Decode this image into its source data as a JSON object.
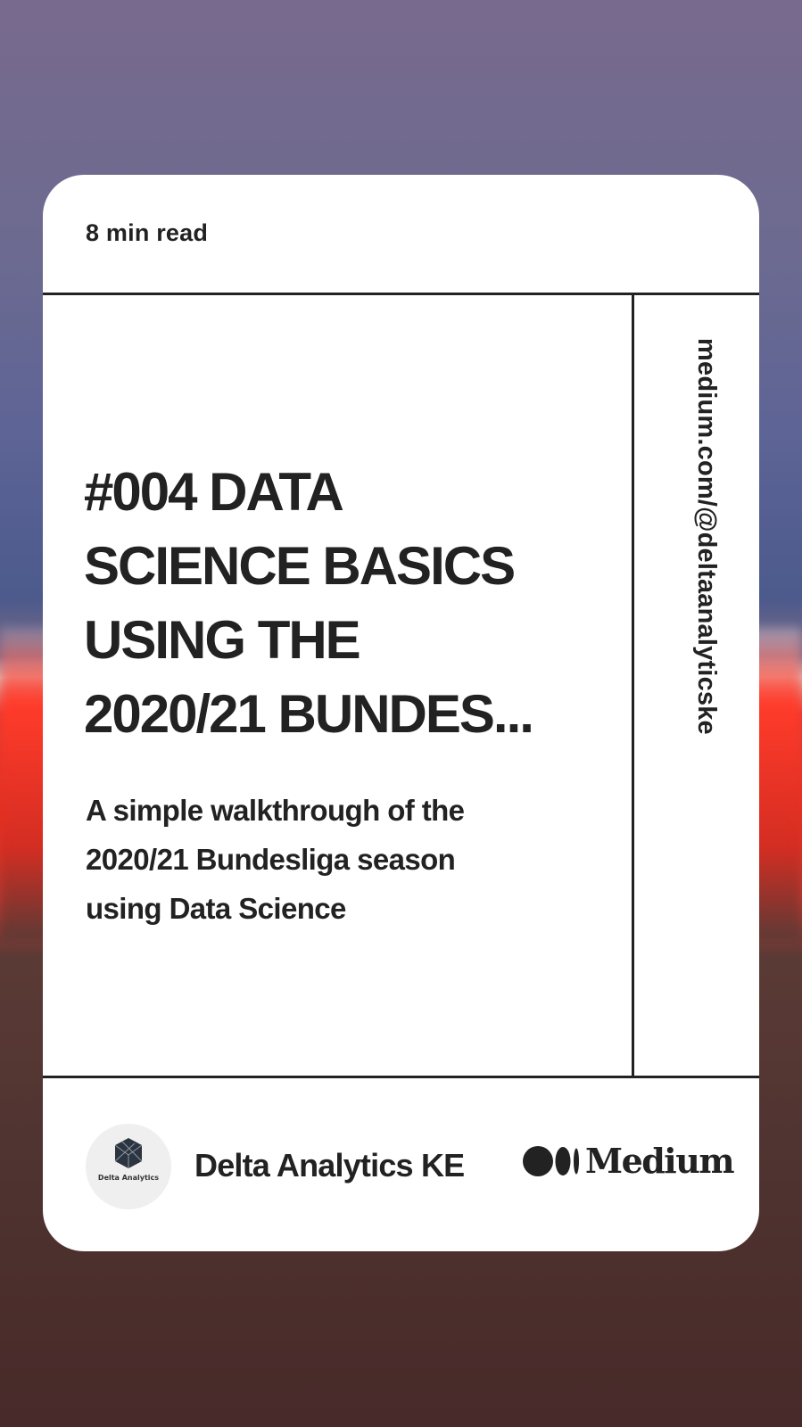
{
  "card": {
    "read_time": "8 min read",
    "headline": "#004 DATA\nSCIENCE BASICS\nUSING THE\n2020/21 BUNDES...",
    "subtitle": "A simple walkthrough of the\n2020/21 Bundesliga season\nusing Data Science",
    "vertical_url": "medium.com/@deltaanalyticske"
  },
  "footer": {
    "avatar_label": "Delta Analytics",
    "publisher": "Delta Analytics KE",
    "platform": "Medium",
    "avatar_icon": "delta-analytics-logo",
    "platform_icon": "medium-logo-icon"
  },
  "colors": {
    "text": "#222222",
    "card": "#ffffff",
    "avatar_bg": "#efefef"
  }
}
